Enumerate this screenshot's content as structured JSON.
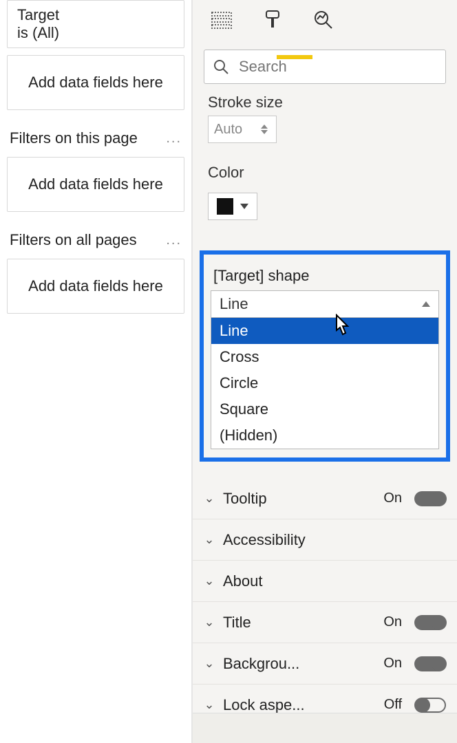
{
  "filters": {
    "visual_filter": {
      "line1": "Target",
      "line2": "is (All)"
    },
    "drop_placeholder": "Add data fields here",
    "page_section": "Filters on this page",
    "all_section": "Filters on all pages"
  },
  "search": {
    "placeholder": "Search"
  },
  "format": {
    "stroke_label": "Stroke size",
    "stroke_value": "Auto",
    "color_label": "Color",
    "color_hex": "#000000"
  },
  "shape_dropdown": {
    "label": "[Target] shape",
    "selected": "Line",
    "options": [
      "Line",
      "Cross",
      "Circle",
      "Square",
      "(Hidden)"
    ]
  },
  "sections": {
    "tooltip": {
      "label": "Tooltip",
      "state": "On"
    },
    "access": {
      "label": "Accessibility"
    },
    "about": {
      "label": "About"
    },
    "title": {
      "label": "Title",
      "state": "On"
    },
    "bg": {
      "label": "Backgrou...",
      "state": "On"
    },
    "lock": {
      "label": "Lock aspe...",
      "state": "Off"
    }
  }
}
